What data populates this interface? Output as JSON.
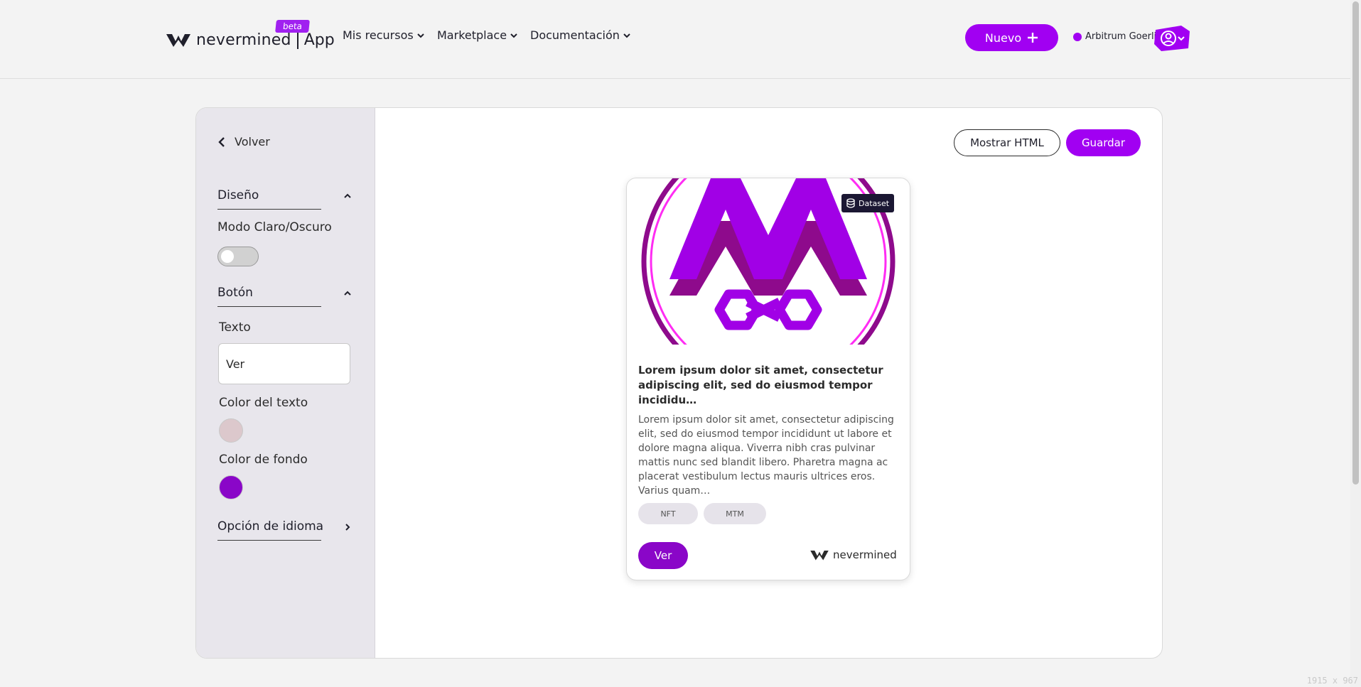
{
  "header": {
    "logo_text": "nevermined",
    "logo_app": "App",
    "beta": "beta",
    "nav": [
      {
        "label": "Mis recursos"
      },
      {
        "label": "Marketplace"
      },
      {
        "label": "Documentación"
      }
    ],
    "new_button": "Nuevo",
    "network": "Arbitrum Goerli",
    "accent_color": "#a100f2"
  },
  "sidebar": {
    "back_label": "Volver",
    "design_section": "Diseño",
    "mode_label": "Modo Claro/Oscuro",
    "mode_dark": false,
    "button_section": "Botón",
    "text_label": "Texto",
    "text_value": "Ver",
    "text_color_label": "Color del texto",
    "text_color": "#dcc8cc",
    "bg_color_label": "Color de fondo",
    "bg_color": "#8a06c8",
    "language_section": "Opción de idioma"
  },
  "main": {
    "show_html_button": "Mostrar HTML",
    "save_button": "Guardar"
  },
  "card": {
    "badge": "Dataset",
    "title": "Lorem ipsum dolor sit amet, consectetur adipiscing elit, sed do eiusmod tempor incididu…",
    "description": "Lorem ipsum dolor sit amet, consectetur adipiscing elit, sed do eiusmod tempor incididunt ut labore et dolore magna aliqua. Viverra nibh cras pulvinar mattis nunc sed blandit libero. Pharetra magna ac placerat vestibulum lectus mauris ultrices eros. Varius quam…",
    "tags": [
      "NFT",
      "MTM"
    ],
    "button": "Ver",
    "brand": "nevermined"
  },
  "screen_dims": "1915 x 967"
}
